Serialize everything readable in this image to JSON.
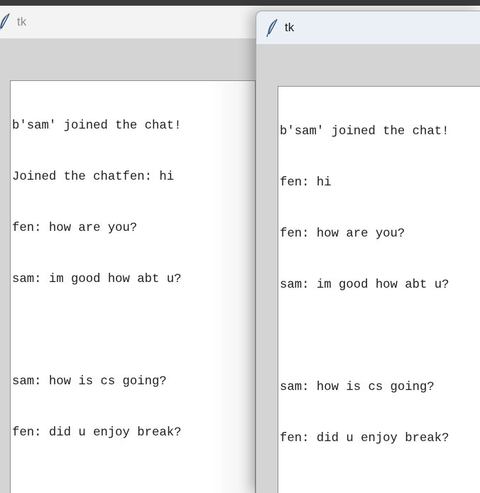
{
  "windows": {
    "back": {
      "title": "tk",
      "chat_lines": [
        "b'sam' joined the chat!",
        "Joined the chatfen: hi",
        "fen: how are you?",
        "sam: im good how abt u?",
        "",
        "sam: how is cs going?",
        "fen: did u enjoy break?"
      ]
    },
    "front": {
      "title": "tk",
      "chat_lines": [
        "b'sam' joined the chat!",
        "fen: hi",
        "fen: how are you?",
        "sam: im good how abt u?",
        "",
        "sam: how is cs going?",
        "fen: did u enjoy break?"
      ]
    }
  },
  "icons": {
    "title_icon": "feather-icon"
  },
  "colors": {
    "window_bg": "#d4d4d4",
    "front_titlebar": "#eaf0f5",
    "back_titlebar": "#f3f3f3",
    "text": "#1e1e1e"
  }
}
